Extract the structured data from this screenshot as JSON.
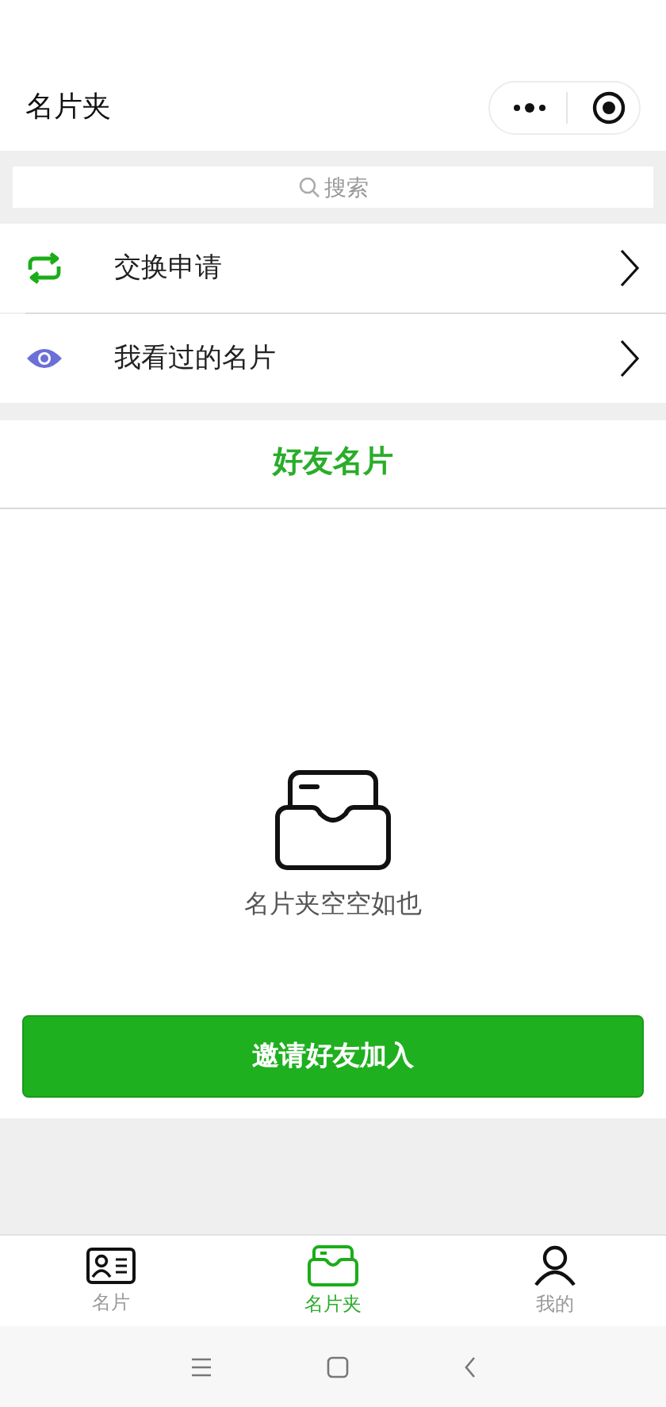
{
  "header": {
    "title": "名片夹"
  },
  "search": {
    "placeholder": "搜索"
  },
  "menu": [
    {
      "kind": "exchange",
      "label": "交换申请"
    },
    {
      "kind": "eye",
      "label": "我看过的名片"
    }
  ],
  "section": {
    "title": "好友名片"
  },
  "empty": {
    "message": "名片夹空空如也"
  },
  "invite_button": "邀请好友加入",
  "tabs": [
    {
      "kind": "card",
      "label": "名片",
      "selected": false
    },
    {
      "kind": "folder",
      "label": "名片夹",
      "selected": true
    },
    {
      "kind": "person",
      "label": "我的",
      "selected": false
    }
  ]
}
